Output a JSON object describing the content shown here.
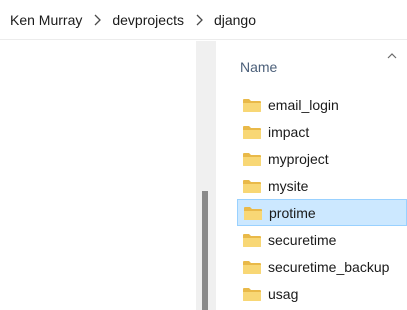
{
  "breadcrumb": {
    "items": [
      "Ken Murray",
      "devprojects",
      "django"
    ]
  },
  "header": {
    "name_label": "Name",
    "sort_icon": "chevron-up-icon"
  },
  "files": [
    {
      "name": "email_login",
      "icon": "folder-icon",
      "selected": false
    },
    {
      "name": "impact",
      "icon": "folder-icon",
      "selected": false
    },
    {
      "name": "myproject",
      "icon": "folder-icon",
      "selected": false
    },
    {
      "name": "mysite",
      "icon": "folder-icon",
      "selected": false
    },
    {
      "name": "protime",
      "icon": "folder-icon",
      "selected": true
    },
    {
      "name": "securetime",
      "icon": "folder-icon",
      "selected": false
    },
    {
      "name": "securetime_backup",
      "icon": "folder-icon",
      "selected": false
    },
    {
      "name": "usag",
      "icon": "folder-icon",
      "selected": false
    }
  ],
  "colors": {
    "selection": "#cce8ff",
    "selection_border": "#99d1ff",
    "folder": "#f8d775"
  }
}
